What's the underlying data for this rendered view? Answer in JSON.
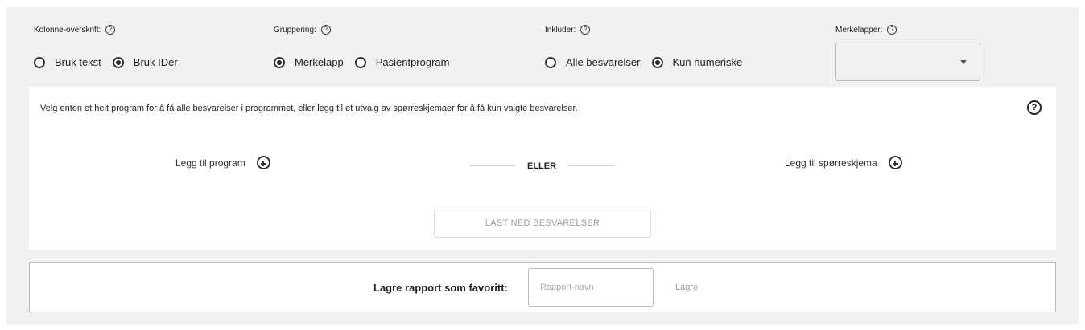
{
  "column_header": {
    "label": "Kolonne-overskrift:",
    "options": [
      "Bruk tekst",
      "Bruk IDer"
    ],
    "selected": "Bruk IDer"
  },
  "grouping": {
    "label": "Gruppering:",
    "options": [
      "Merkelapp",
      "Pasientprogram"
    ],
    "selected": "Merkelapp"
  },
  "include": {
    "label": "Inkluder:",
    "options": [
      "Alle besvarelser",
      "Kun numeriske"
    ],
    "selected": "Kun numeriske"
  },
  "labels_filter": {
    "label": "Merkelapper:",
    "value": ""
  },
  "help_glyph": "?",
  "selection": {
    "info_text": "Velg enten et helt program for å få alle besvarelser i programmet, eller legg til et utvalg av spørreskjemaer for å få kun valgte besvarelser.",
    "add_program_label": "Legg til program",
    "or_label": "ELLER",
    "add_questionnaire_label": "Legg til spørreskjema",
    "download_button": "LAST NED BESVARELSER"
  },
  "favorite": {
    "label": "Lagre rapport som favoritt:",
    "input_placeholder": "Rapport-navn",
    "save_label": "Lagre"
  }
}
